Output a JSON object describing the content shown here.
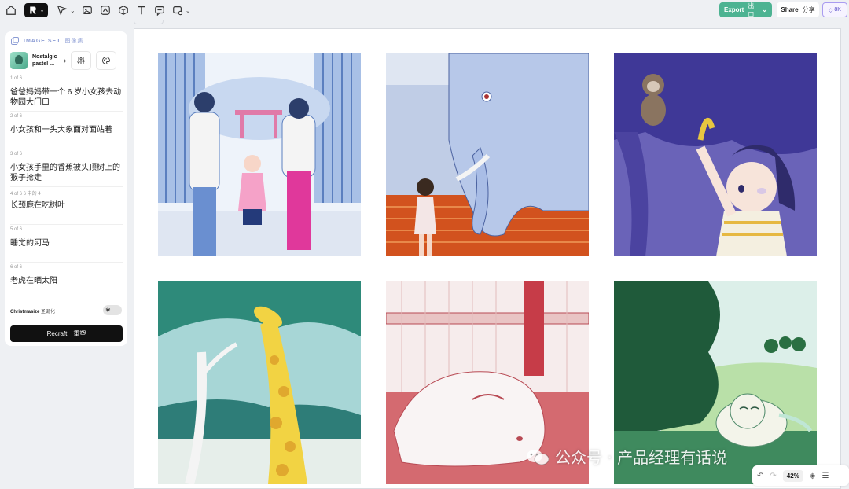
{
  "toolbar": {
    "tools": [
      "home-icon",
      "logo-brand-icon",
      "select-arrow-icon",
      "image-icon",
      "image-edit-icon",
      "shapes-icon",
      "text-icon",
      "comment-icon",
      "magic-brush-icon"
    ],
    "export_label": "Export",
    "export_label_zh": "出口",
    "share_label": "Share",
    "share_label_zh": "分享",
    "credits": "8K"
  },
  "panel": {
    "header_label": "IMAGE SET",
    "header_label_zh": "图像集",
    "style_name": "Nostalgic pastel ...",
    "items": [
      {
        "index": "1 of 6",
        "text": "爸爸妈妈带一个 6 岁小女孩去动物园大门口"
      },
      {
        "index": "2 of 6",
        "text": "小女孩和一头大象面对面站着"
      },
      {
        "index": "3 of 6",
        "text": "小女孩手里的香蕉被头顶树上的猴子抢走"
      },
      {
        "index": "4 of 6 6 中的 4",
        "text": "长颈鹿在吃树叶"
      },
      {
        "index": "5 of 6",
        "text": "睡觉的河马"
      },
      {
        "index": "6 of 6",
        "text": "老虎在晒太阳"
      }
    ],
    "christmas_label": "Christmasize",
    "christmas_label_zh": "圣诞化",
    "recraft_label": "Recraft",
    "recraft_label_zh": "重塑"
  },
  "zoom": {
    "value": "42%"
  },
  "watermark": {
    "text": "公众号 · 产品经理有话说"
  },
  "colors": {
    "export": "#4db392",
    "accent": "#4b3fc4"
  }
}
